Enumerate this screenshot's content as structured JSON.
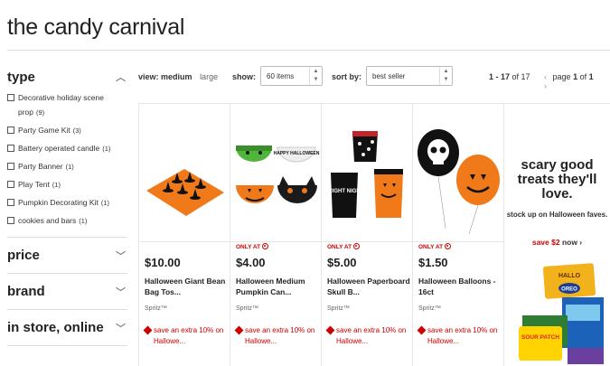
{
  "page": {
    "title": "the candy carnival"
  },
  "sidebar": {
    "type_heading": "type",
    "type_items": [
      {
        "label": "Decorative holiday scene prop",
        "count": "(9)"
      },
      {
        "label": "Party Game Kit",
        "count": "(3)"
      },
      {
        "label": "Battery operated candle",
        "count": "(1)"
      },
      {
        "label": "Party Banner",
        "count": "(1)"
      },
      {
        "label": "Play Tent",
        "count": "(1)"
      },
      {
        "label": "Pumpkin Decorating Kit",
        "count": "(1)"
      },
      {
        "label": "cookies and bars",
        "count": "(1)"
      }
    ],
    "price_heading": "price",
    "brand_heading": "brand",
    "store_heading": "in store, online"
  },
  "toolbar": {
    "view_label": "view:",
    "view_selected": "medium",
    "view_other": "large",
    "show_label": "show:",
    "show_value": "60 items",
    "sort_label": "sort by:",
    "sort_value": "best seller",
    "range": "1 - 17",
    "range_of": "of 17",
    "page_label": "page",
    "page_current": "1",
    "page_of": "of",
    "page_total": "1"
  },
  "products": [
    {
      "only_at": "",
      "price": "$10.00",
      "name": "Halloween Giant Bean Bag Tos...",
      "brand": "Spritz™",
      "promo": "save an extra 10% on Hallowe..."
    },
    {
      "only_at": "ONLY AT",
      "price": "$4.00",
      "name": "Halloween Medium Pumpkin Can...",
      "brand": "Spritz™",
      "promo": "save an extra 10% on Hallowe..."
    },
    {
      "only_at": "ONLY AT",
      "price": "$5.00",
      "name": "Halloween Paperboard Skull B...",
      "brand": "Spritz™",
      "promo": "save an extra 10% on Hallowe..."
    },
    {
      "only_at": "ONLY AT",
      "price": "$1.50",
      "name": "Halloween Balloons - 16ct",
      "brand": "Spritz™",
      "promo": "save an extra 10% on Hallowe..."
    }
  ],
  "promo_card": {
    "headline": "scary good treats they'll love.",
    "subline": "stock up on Halloween faves.",
    "offer": "save $2",
    "offer_suffix": "now ›",
    "image_texts": {
      "hallo": "HALLO",
      "oreo": "OREO",
      "sour_patch": "SOUR PATCH",
      "bowl_text": "HAPPY HALLOWEEN",
      "box_text": "FRIGHT NIGHT"
    }
  },
  "colors": {
    "accent_red": "#cc0000",
    "orange": "#f07a1a",
    "text_dark": "#222222"
  },
  "icons": {
    "chevron": "chevron-up-icon",
    "checkbox": "checkbox-icon",
    "tag": "price-tag-icon",
    "bullseye": "target-bullseye-icon"
  }
}
